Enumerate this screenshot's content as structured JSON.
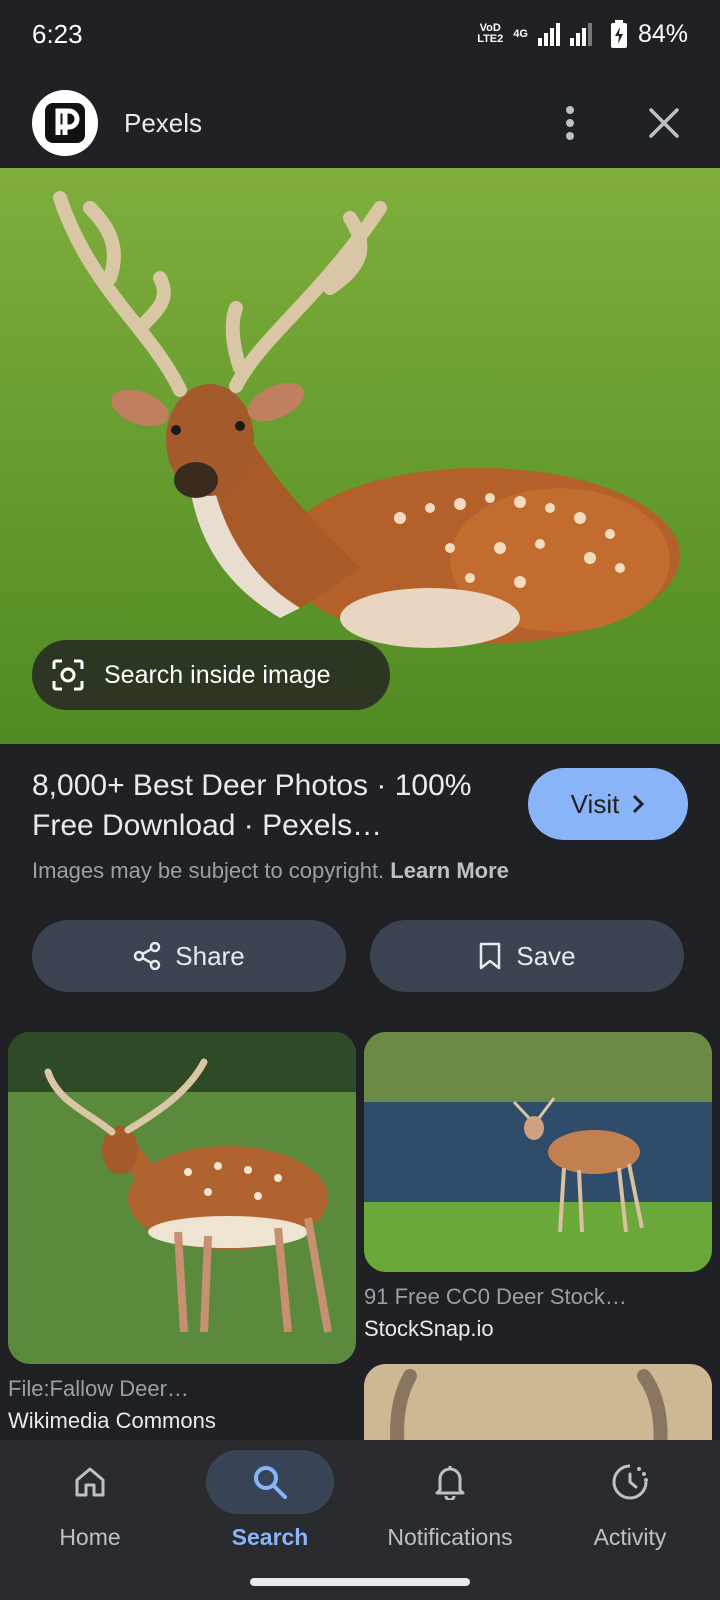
{
  "status": {
    "time": "6:23",
    "network_top": "VoD",
    "network_bottom": "LTE2",
    "net_type": "4G",
    "battery": "84%"
  },
  "header": {
    "site_name": "Pexels"
  },
  "hero": {
    "search_inside_label": "Search inside image"
  },
  "result": {
    "title": "8,000+ Best Deer Photos · 100% Free Download · Pexels…",
    "visit_label": "Visit",
    "copyright_text": "Images may be subject to copyright.",
    "learn_more": "Learn More"
  },
  "actions": {
    "share": "Share",
    "save": "Save"
  },
  "related": [
    {
      "title": "File:Fallow Deer…",
      "source": "Wikimedia Commons"
    },
    {
      "title": "91 Free CC0 Deer Stock…",
      "source": "StockSnap.io"
    }
  ],
  "nav": {
    "home": "Home",
    "search": "Search",
    "notifications": "Notifications",
    "activity": "Activity"
  },
  "colors": {
    "accent": "#8ab4f8",
    "background": "#202124",
    "button_bg": "#3c4452"
  }
}
